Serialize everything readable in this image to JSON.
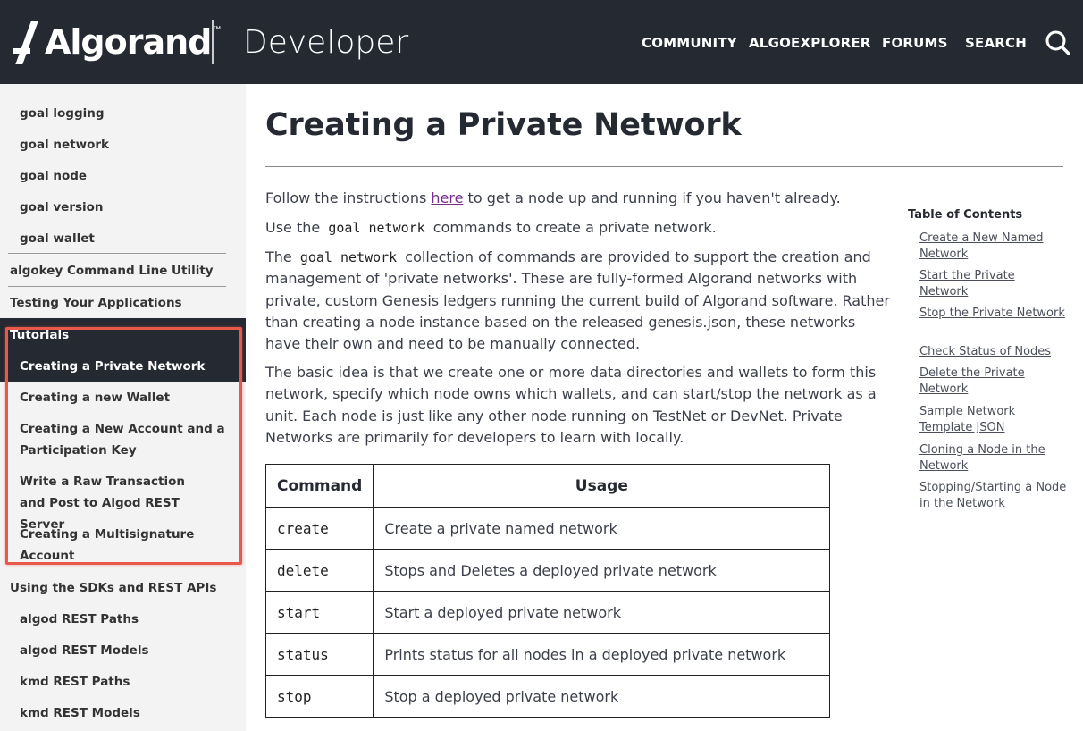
{
  "header": {
    "logo_text": "Algorand",
    "logo_tm": "™",
    "title": "Developer",
    "nav": [
      "COMMUNITY",
      "ALGOEXPLORER",
      "FORUMS",
      "SEARCH"
    ],
    "search_icon": "search-icon",
    "background_color": "#252932"
  },
  "sidebar": {
    "items_top": [
      "goal logging",
      "goal network",
      "goal node",
      "goal version",
      "goal wallet"
    ],
    "section_algokey": "algokey Command Line Utility",
    "section_testing": "Testing Your Applications",
    "section_tutorials": "Tutorials",
    "tutorials": [
      "Creating a Private Network",
      "Creating a new Wallet",
      "Creating a New Account and a Participation Key",
      "Write a Raw Transaction and Post to Algod REST Server",
      "Creating a Multisignature Account"
    ],
    "section_sdks": "Using the SDKs and REST APIs",
    "items_bottom": [
      "algod REST Paths",
      "algod REST Models",
      "kmd REST Paths",
      "kmd REST Models"
    ],
    "highlight_color": "#e8594b"
  },
  "main": {
    "title": "Creating a Private Network",
    "p1_before": "Follow the instructions ",
    "p1_link": "here",
    "p1_after": " to get a node up and running if you haven't already.",
    "p2_before": "Use the ",
    "p2_code": "goal network",
    "p2_after": " commands to create a private network.",
    "p3_before": "The ",
    "p3_code": "goal network",
    "p3_after": " collection of commands are provided to support the creation and management of 'private networks'. These are fully-formed Algorand networks with private, custom Genesis ledgers running the current build of Algorand software. Rather than creating a node instance based on the released genesis.json, these networks have their own and need to be manually connected.",
    "p4": "The basic idea is that we create one or more data directories and wallets to form this network, specify which node owns which wallets, and can start/stop the network as a unit. Each node is just like any other node running on TestNet or DevNet. Private Networks are primarily for developers to learn with locally.",
    "table": {
      "headers": [
        "Command",
        "Usage"
      ],
      "rows": [
        [
          "create",
          "Create a private named network"
        ],
        [
          "delete",
          "Stops and Deletes a deployed private network"
        ],
        [
          "start",
          "Start a deployed private network"
        ],
        [
          "status",
          "Prints status for all nodes in a deployed private network"
        ],
        [
          "stop",
          "Stop a deployed private network"
        ]
      ]
    }
  },
  "toc": {
    "heading": "Table of Contents",
    "links": [
      "Create a New Named Network",
      "Start the Private Network",
      "Stop the Private Network",
      "Check Status of Nodes",
      "Delete the Private Network",
      "Sample Network Template JSON",
      "Cloning a Node in the Network",
      "Stopping/Starting a Node in the Network"
    ]
  }
}
